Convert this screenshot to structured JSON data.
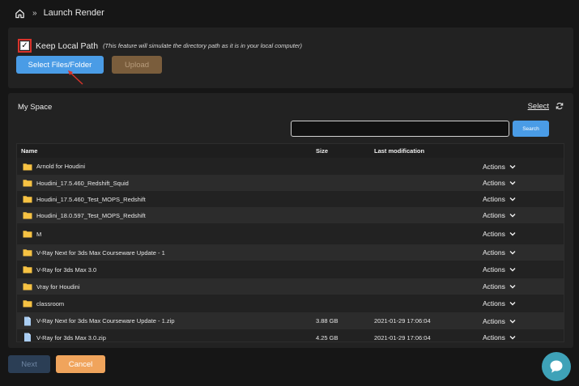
{
  "breadcrumb": {
    "home_icon": "home-icon",
    "separator": "»",
    "title": "Launch Render"
  },
  "upload": {
    "keep_local_label": "Keep Local Path",
    "keep_local_note": "(This feature will simulate the directory path as it is in your local computer)",
    "keep_local_checked": true,
    "select_button": "Select Files/Folder",
    "upload_button": "Upload"
  },
  "space": {
    "title": "My Space",
    "select_link": "Select",
    "search_placeholder": "",
    "search_button": "Search",
    "columns": {
      "name": "Name",
      "size": "Size",
      "modified": "Last modification"
    },
    "actions_label": "Actions",
    "rows": [
      {
        "type": "folder",
        "name": "Arnold for Houdini",
        "size": "",
        "modified": ""
      },
      {
        "type": "folder",
        "name": "Houdini_17.5.460_Redshift_Squid",
        "size": "",
        "modified": ""
      },
      {
        "type": "folder",
        "name": "Houdini_17.5.460_Test_MOPS_Redshift",
        "size": "",
        "modified": ""
      },
      {
        "type": "folder",
        "name": "Houdini_18.0.597_Test_MOPS_Redshift",
        "size": "",
        "modified": ""
      },
      {
        "type": "folder",
        "name": "M",
        "size": "",
        "modified": ""
      },
      {
        "type": "folder",
        "name": "V-Ray Next for 3ds Max Courseware Update - 1",
        "size": "",
        "modified": ""
      },
      {
        "type": "folder",
        "name": "V-Ray for 3ds Max 3.0",
        "size": "",
        "modified": ""
      },
      {
        "type": "folder",
        "name": "Vray for Houdini",
        "size": "",
        "modified": ""
      },
      {
        "type": "folder",
        "name": "classroom",
        "size": "",
        "modified": ""
      },
      {
        "type": "file",
        "name": "V-Ray Next for 3ds Max Courseware Update - 1.zip",
        "size": "3.88 GB",
        "modified": "2021-01-29 17:06:04"
      },
      {
        "type": "file",
        "name": "V-Ray for 3ds Max 3.0.zip",
        "size": "4.25 GB",
        "modified": "2021-01-29 17:06:04"
      }
    ]
  },
  "footer": {
    "next_button": "Next",
    "cancel_button": "Cancel"
  },
  "colors": {
    "accent_blue": "#4a9ce6",
    "cancel_orange": "#f0a45c",
    "upload_disabled": "#7a5d3c",
    "checkbox_highlight": "#d9332b",
    "chat_teal": "#3ea2b8"
  }
}
